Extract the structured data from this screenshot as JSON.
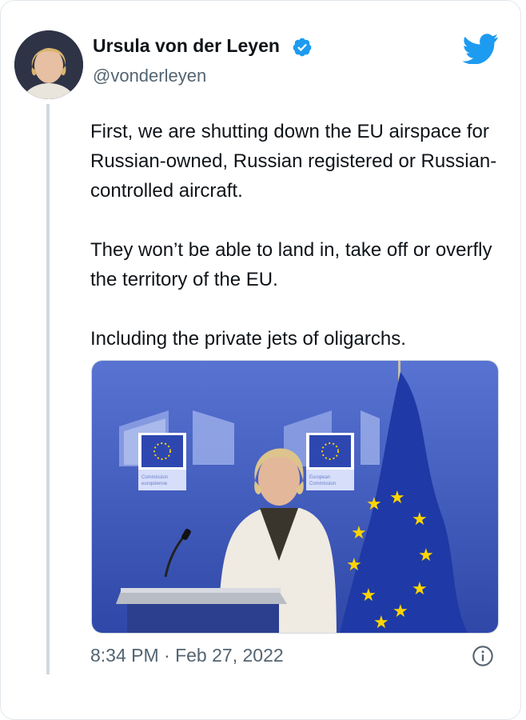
{
  "tweet": {
    "author_name": "Ursula von der Leyen",
    "author_handle": "@vonderleyen",
    "paragraphs": [
      "First, we are shutting down the EU airspace for Russian-owned, Russian registered or Russian-controlled aircraft.",
      "They won’t be able to land in, take off or overfly the territory of the EU.",
      "Including the private jets of oligarchs."
    ],
    "timestamp": "8:34 PM · Feb 27, 2022"
  },
  "media": {
    "backdrop_sign_left": [
      "Commission",
      "européenne"
    ],
    "backdrop_sign_right": [
      "European",
      "Commission"
    ]
  },
  "colors": {
    "twitter_blue": "#1d9bf0",
    "eu_blue": "#2a3fb0",
    "eu_star": "#ffd500",
    "backdrop_blue": "#3d5fc4"
  },
  "icons": {
    "verified": "verified-badge-icon",
    "brand": "twitter-bird-icon",
    "info": "info-icon"
  }
}
